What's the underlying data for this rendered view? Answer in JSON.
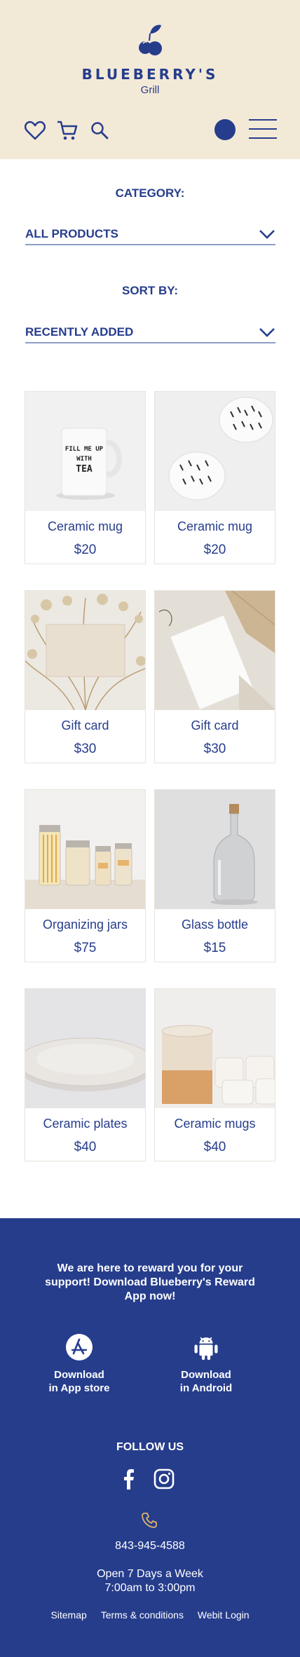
{
  "brand": {
    "name": "BLUEBERRY'S",
    "subtitle": "Grill"
  },
  "header": {
    "icons": [
      "heart-icon",
      "cart-icon",
      "search-icon",
      "user-avatar",
      "hamburger-menu-icon"
    ]
  },
  "filters": {
    "category_label": "CATEGORY:",
    "category_value": "ALL PRODUCTS",
    "sort_label": "SORT BY:",
    "sort_value": "RECENTLY ADDED"
  },
  "products": [
    {
      "name": "Ceramic mug",
      "price": "$20"
    },
    {
      "name": "Ceramic mug",
      "price": "$20"
    },
    {
      "name": "Gift card",
      "price": "$30"
    },
    {
      "name": "Gift card",
      "price": "$30"
    },
    {
      "name": "Organizing jars",
      "price": "$75"
    },
    {
      "name": "Glass bottle",
      "price": "$15"
    },
    {
      "name": "Ceramic plates",
      "price": "$40"
    },
    {
      "name": "Ceramic mugs",
      "price": "$40"
    }
  ],
  "mug_print": {
    "line1": "FILL ME UP",
    "line2": "WITH",
    "line3": "TEA"
  },
  "footer": {
    "message": "We are here to reward you for your support! Download Blueberry's Reward App now!",
    "appstore_line1": "Download",
    "appstore_line2": "in App store",
    "android_line1": "Download",
    "android_line2": "in Android",
    "follow_label": "FOLLOW US",
    "phone": "843-945-4588",
    "hours_line1": "Open 7 Days a Week",
    "hours_line2": "7:00am to 3:00pm",
    "links": [
      "Sitemap",
      "Terms & conditions",
      "Webit Login"
    ]
  },
  "colors": {
    "brand_blue": "#263d8c",
    "header_bg": "#f3e9d7",
    "accent_gold": "#e0b36a"
  }
}
